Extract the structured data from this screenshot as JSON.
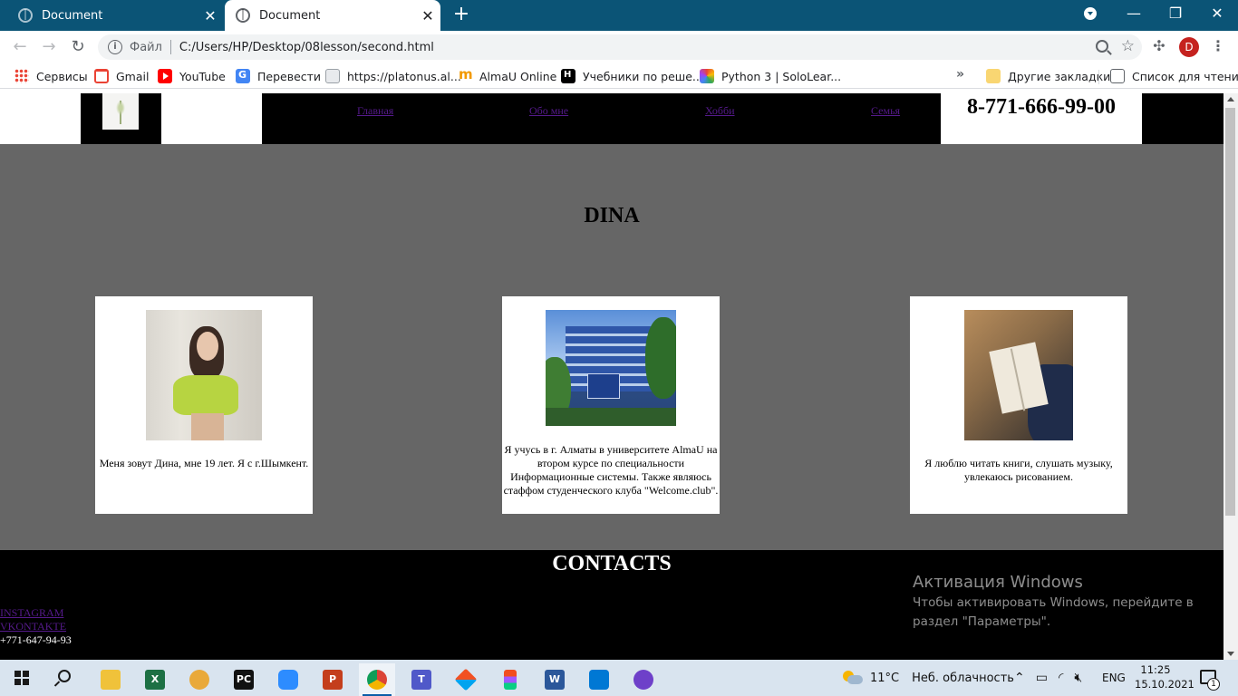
{
  "browser": {
    "tabs": [
      {
        "title": "Document",
        "active": false
      },
      {
        "title": "Document",
        "active": true
      }
    ],
    "new_tab_symbol": "+",
    "address": {
      "scheme_label": "Файл",
      "url": "C:/Users/HP/Desktop/08lesson/second.html"
    },
    "profile_initial": "D",
    "bookmarks": [
      {
        "label": "Сервисы",
        "icon": "apps-icon"
      },
      {
        "label": "Gmail",
        "icon": "gmail-icon"
      },
      {
        "label": "YouTube",
        "icon": "youtube-icon"
      },
      {
        "label": "Перевести",
        "icon": "translate-icon"
      },
      {
        "label": "https://platonus.al...",
        "icon": "platonus-icon"
      },
      {
        "label": "AlmaU Online",
        "icon": "almau-icon"
      },
      {
        "label": "Учебники по реше...",
        "icon": "books-icon"
      },
      {
        "label": "Python 3 | SoloLear...",
        "icon": "sololearn-icon"
      }
    ],
    "bookmarks_right": [
      {
        "label": "Другие закладки",
        "icon": "folder-icon"
      },
      {
        "label": "Список для чтения",
        "icon": "reading-list-icon"
      }
    ]
  },
  "page": {
    "nav": [
      "Главная",
      "Обо мне",
      "Хобби",
      "Семья"
    ],
    "phone": "8-771-666-99-00",
    "title": "DINA",
    "cards": [
      {
        "caption": "Меня зовут Дина, мне 19 лет. Я с г.Шымкент.",
        "image": "girl-photo"
      },
      {
        "caption": "Я учусь в г. Алматы в университете AlmaU на втором курсе по специальности Информационные системы. Также являюсь стаффом студенческого клуба \"Welcome.club\".",
        "image": "university-photo"
      },
      {
        "caption": "Я люблю читать книги, слушать музыку, увлекаюсь рисованием.",
        "image": "book-photo"
      }
    ],
    "contacts": {
      "title": "CONTACTS",
      "links": [
        "INSTAGRAM",
        "VKONTAKTE"
      ],
      "phone": "+771-647-94-93"
    }
  },
  "watermark": {
    "title": "Активация Windows",
    "text": "Чтобы активировать Windows, перейдите в раздел \"Параметры\"."
  },
  "taskbar": {
    "apps": [
      {
        "name": "file-explorer",
        "label": ""
      },
      {
        "name": "excel",
        "label": "X"
      },
      {
        "name": "paint",
        "label": ""
      },
      {
        "name": "pycharm",
        "label": "PC"
      },
      {
        "name": "zoom",
        "label": ""
      },
      {
        "name": "powerpoint",
        "label": "P"
      },
      {
        "name": "chrome",
        "label": ""
      },
      {
        "name": "teams",
        "label": "T"
      },
      {
        "name": "app-generic",
        "label": ""
      },
      {
        "name": "figma",
        "label": ""
      },
      {
        "name": "word",
        "label": "W"
      },
      {
        "name": "vscode",
        "label": ""
      },
      {
        "name": "github-desktop",
        "label": ""
      }
    ],
    "weather": {
      "temp": "11°C",
      "desc": "Неб. облачность"
    },
    "language": "ENG",
    "time": "11:25",
    "date": "15.10.2021",
    "notifications": "1"
  },
  "colors": {
    "titlebar": "#0b5476",
    "page_gray": "#666666",
    "link": "#551a8b"
  }
}
